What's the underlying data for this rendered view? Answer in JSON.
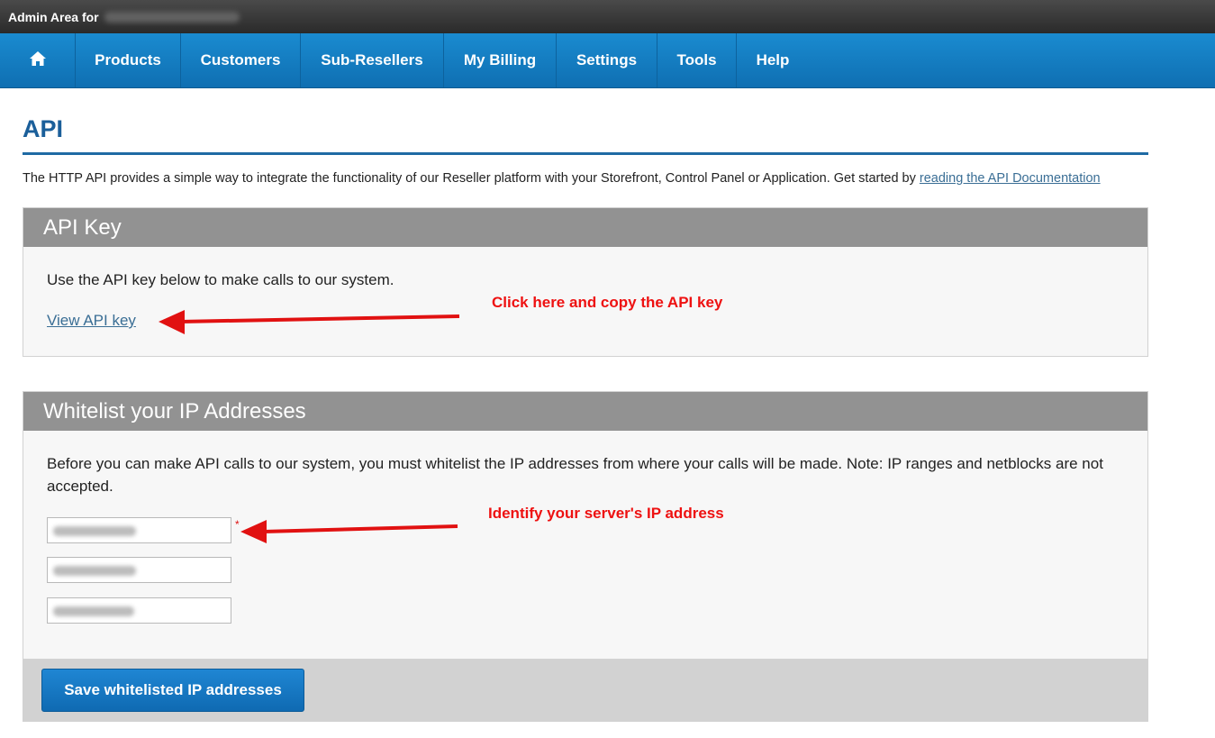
{
  "admin_bar": {
    "label": "Admin Area for"
  },
  "nav": {
    "home_icon": "home-icon",
    "items": [
      {
        "label": "Products"
      },
      {
        "label": "Customers"
      },
      {
        "label": "Sub-Resellers"
      },
      {
        "label": "My Billing"
      },
      {
        "label": "Settings"
      },
      {
        "label": "Tools"
      },
      {
        "label": "Help"
      }
    ]
  },
  "page": {
    "title": "API",
    "intro_text": "The HTTP API provides a simple way to integrate the functionality of our Reseller platform with your Storefront, Control Panel or Application. Get started by ",
    "intro_link": "reading the API Documentation"
  },
  "api_key_panel": {
    "heading": "API Key",
    "description": "Use the API key below to make calls to our system.",
    "view_link": "View API key"
  },
  "ip_panel": {
    "heading": "Whitelist your IP Addresses",
    "description": "Before you can make API calls to our system, you must whitelist the IP addresses from where your calls will be made. Note: IP ranges and netblocks are not accepted.",
    "required_mark": "*",
    "save_button": "Save whitelisted IP addresses"
  },
  "annotations": {
    "api_key_note": "Click here and copy the API key",
    "ip_note": "Identify your server's IP address",
    "color": "#e11111"
  },
  "colors": {
    "nav_blue": "#1580c6",
    "title_blue": "#1b5f9a",
    "panel_header_gray": "#929292"
  }
}
